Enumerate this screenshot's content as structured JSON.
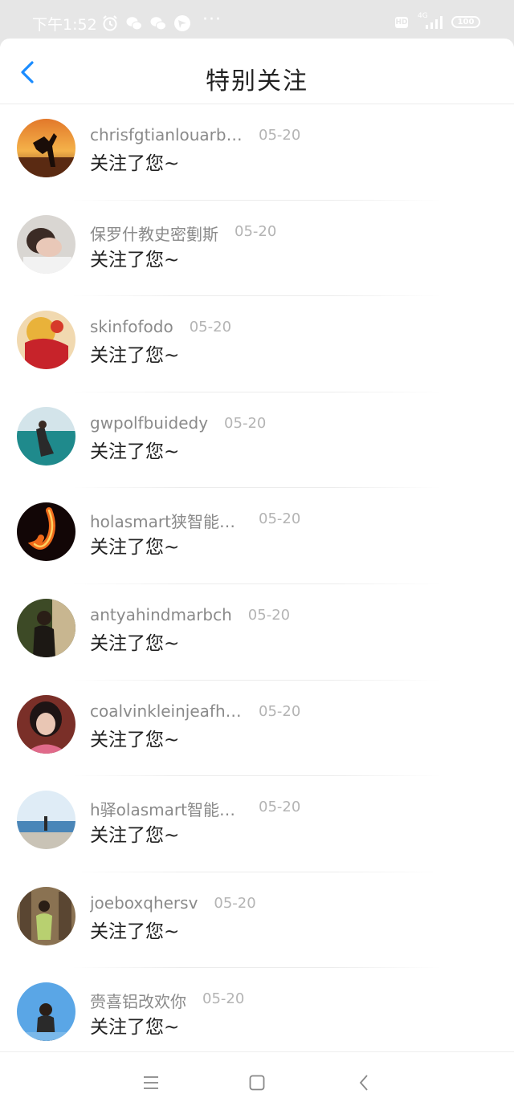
{
  "status_bar": {
    "time": "下午1:52",
    "network": "4G",
    "battery": "100",
    "more": "···",
    "hd": "HD",
    "icons": [
      "alarm-icon",
      "wechat-icon",
      "wechat-icon",
      "app-icon"
    ]
  },
  "header": {
    "title": "特别关注",
    "back_icon": "chevron-left-icon",
    "accent": "#1a8cff"
  },
  "items": [
    {
      "name": "chrisfgtianlouarbo...",
      "date": "05-20",
      "message": "关注了您~"
    },
    {
      "name": "保罗什教史密劐斯",
      "date": "05-20",
      "message": "关注了您~"
    },
    {
      "name": "skinfofodo",
      "date": "05-20",
      "message": "关注了您~"
    },
    {
      "name": "gwpolfbuidedy",
      "date": "05-20",
      "message": "关注了您~"
    },
    {
      "name": "holasmart狭智能手...",
      "date": "05-20",
      "message": "关注了您~"
    },
    {
      "name": "antyahindmarbch",
      "date": "05-20",
      "message": "关注了您~"
    },
    {
      "name": "coalvinkleinjeafhns",
      "date": "05-20",
      "message": "关注了您~"
    },
    {
      "name": "h驿olasmart智能手...",
      "date": "05-20",
      "message": "关注了您~"
    },
    {
      "name": "joeboxqhersv",
      "date": "05-20",
      "message": "关注了您~"
    },
    {
      "name": "赍喜铝改欢你",
      "date": "05-20",
      "message": "关注了您~"
    }
  ],
  "nav_bar": {
    "icons": [
      "menu-icon",
      "home-icon",
      "back-icon"
    ]
  }
}
